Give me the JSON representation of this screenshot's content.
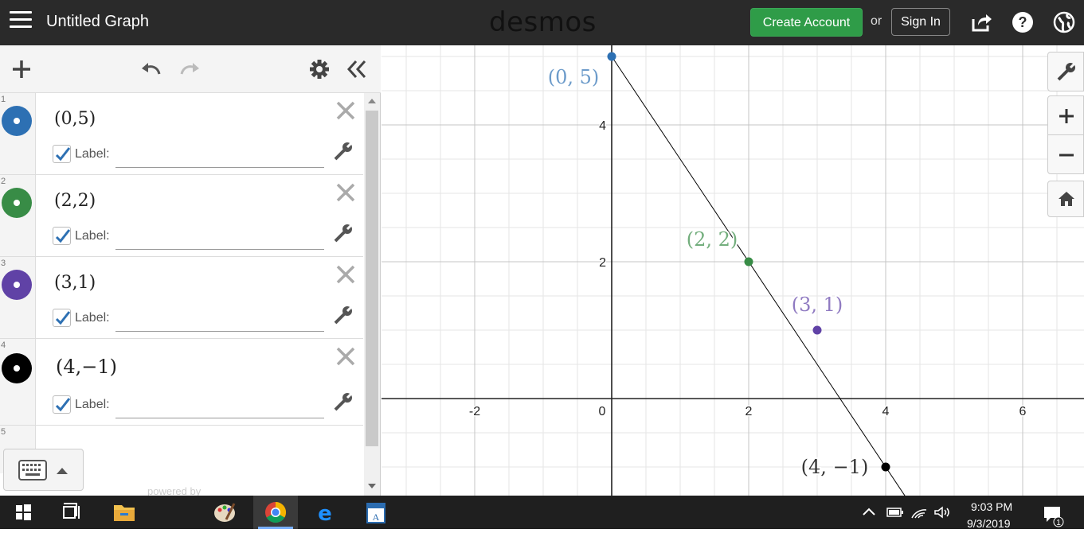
{
  "header": {
    "title": "Untitled Graph",
    "logo": "desmos",
    "create_account": "Create Account",
    "or": "or",
    "sign_in": "Sign In"
  },
  "expressions": [
    {
      "num": "1",
      "math": "(0,5)",
      "label": "Label:",
      "color": "#2d70b3",
      "checked": true
    },
    {
      "num": "2",
      "math": "(2,2)",
      "label": "Label:",
      "color": "#388c46",
      "checked": true
    },
    {
      "num": "3",
      "math": "(3,1)",
      "label": "Label:",
      "color": "#6042a6",
      "checked": true
    },
    {
      "num": "4",
      "math": "(4,−1)",
      "label": "Label:",
      "color": "#000000",
      "checked": true
    },
    {
      "num": "5"
    }
  ],
  "footer": {
    "powered_by": "powered by"
  },
  "graph": {
    "x_ticks": [
      "-2",
      "0",
      "2",
      "4",
      "6"
    ],
    "y_ticks": [
      "4",
      "2"
    ],
    "points": [
      {
        "x": 0,
        "y": 5,
        "label": "(0, 5)",
        "color": "#2d70b3"
      },
      {
        "x": 2,
        "y": 2,
        "label": "(2, 2)",
        "color": "#388c46"
      },
      {
        "x": 3,
        "y": 1,
        "label": "(3, 1)",
        "color": "#6042a6"
      },
      {
        "x": 4,
        "y": -1,
        "label": "(4, −1)",
        "color": "#000000"
      }
    ],
    "line": {
      "from": [
        0,
        5
      ],
      "to": [
        4,
        -1
      ]
    }
  },
  "taskbar": {
    "time": "9:03 PM",
    "date": "9/3/2019",
    "notification_count": "1"
  }
}
